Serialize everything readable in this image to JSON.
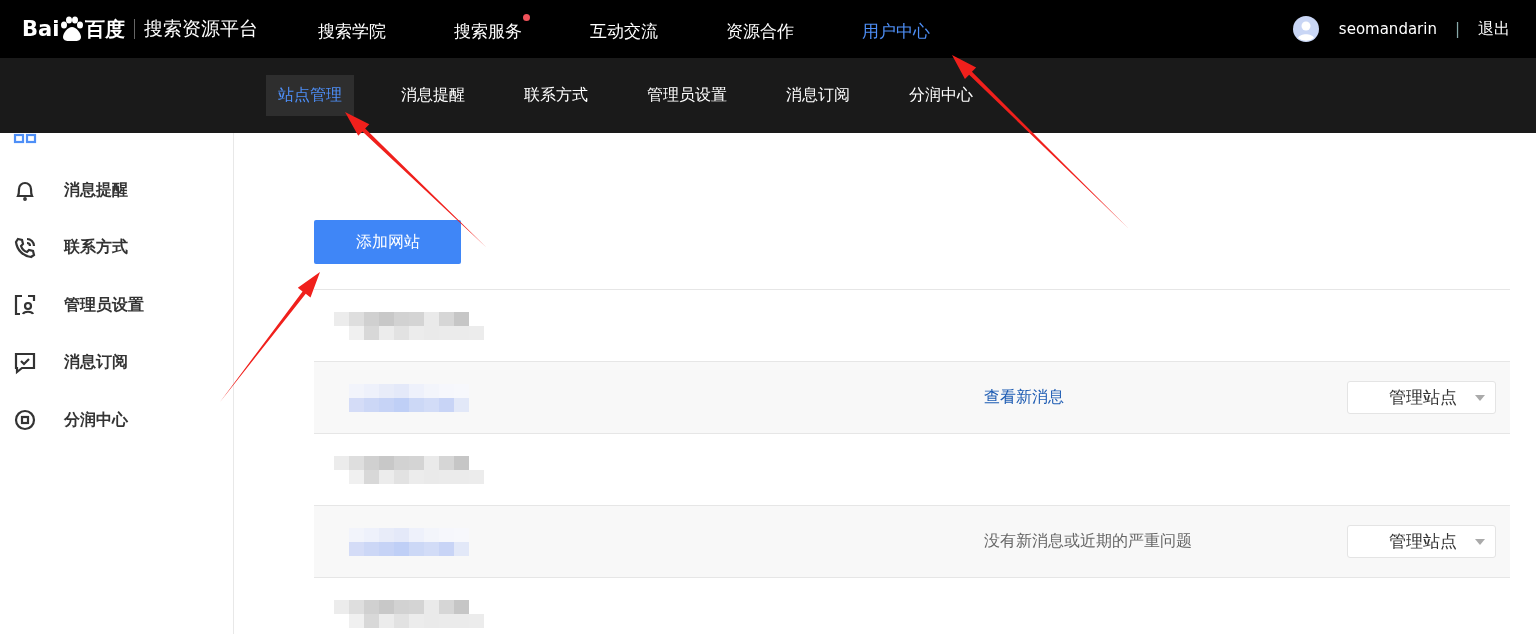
{
  "header": {
    "logo": {
      "latin": "Bai",
      "cjk": "百度"
    },
    "platform": "搜索资源平台",
    "nav": [
      {
        "label": "搜索学院",
        "selected": false,
        "badge_dot": false
      },
      {
        "label": "搜索服务",
        "selected": false,
        "badge_dot": true
      },
      {
        "label": "互动交流",
        "selected": false,
        "badge_dot": false
      },
      {
        "label": "资源合作",
        "selected": false,
        "badge_dot": false
      },
      {
        "label": "用户中心",
        "selected": true,
        "badge_dot": false
      }
    ],
    "user": {
      "name": "seomandarin",
      "separator": "|",
      "logout": "退出"
    }
  },
  "sub_nav": [
    {
      "label": "站点管理",
      "selected": true
    },
    {
      "label": "消息提醒",
      "selected": false
    },
    {
      "label": "联系方式",
      "selected": false
    },
    {
      "label": "管理员设置",
      "selected": false
    },
    {
      "label": "消息订阅",
      "selected": false
    },
    {
      "label": "分润中心",
      "selected": false
    }
  ],
  "sidebar": [
    {
      "kind": "sites",
      "selected": true
    },
    {
      "label": "消息提醒",
      "kind": "bell",
      "selected": false
    },
    {
      "label": "联系方式",
      "kind": "phone",
      "selected": false
    },
    {
      "label": "管理员设置",
      "kind": "admin",
      "selected": false
    },
    {
      "label": "消息订阅",
      "kind": "subscribe",
      "selected": false
    },
    {
      "label": "分润中心",
      "kind": "revenue",
      "selected": false
    }
  ],
  "page": {
    "add_button": "添加网站",
    "rows": [
      {
        "kind": "group"
      },
      {
        "kind": "site",
        "message": "查看新消息",
        "message_is_link": true,
        "action": "管理站点"
      },
      {
        "kind": "group"
      },
      {
        "kind": "site",
        "message": "没有新消息或近期的严重问题",
        "message_is_link": false,
        "action": "管理站点"
      },
      {
        "kind": "group"
      }
    ]
  },
  "annotations": [
    {
      "kind": "arrow"
    },
    {
      "kind": "arrow"
    },
    {
      "kind": "arrow"
    }
  ]
}
